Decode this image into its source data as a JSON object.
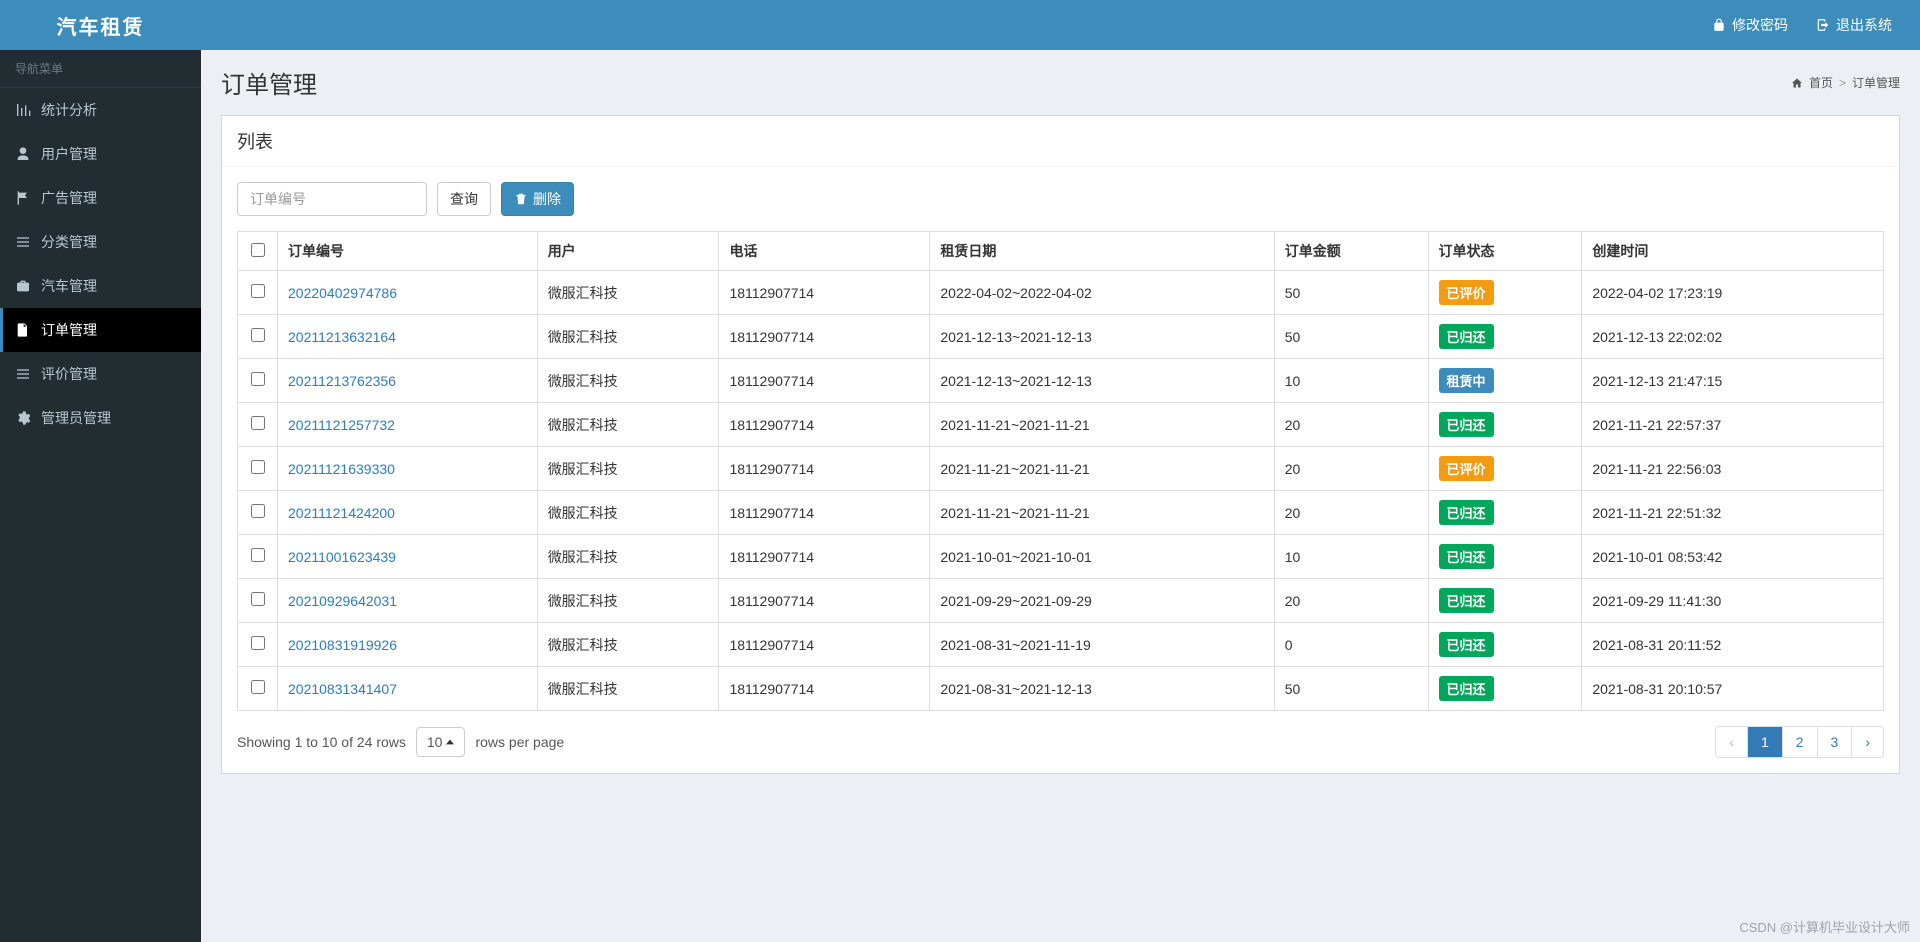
{
  "brand": "汽车租赁",
  "topActions": {
    "changePassword": "修改密码",
    "logout": "退出系统"
  },
  "sidebar": {
    "header": "导航菜单",
    "items": [
      {
        "label": "统计分析",
        "icon": "bar-chart"
      },
      {
        "label": "用户管理",
        "icon": "user"
      },
      {
        "label": "广告管理",
        "icon": "flag"
      },
      {
        "label": "分类管理",
        "icon": "list"
      },
      {
        "label": "汽车管理",
        "icon": "briefcase"
      },
      {
        "label": "订单管理",
        "icon": "file",
        "active": true
      },
      {
        "label": "评价管理",
        "icon": "list"
      },
      {
        "label": "管理员管理",
        "icon": "gear"
      }
    ]
  },
  "page": {
    "title": "订单管理",
    "breadcrumb": {
      "home": "首页",
      "current": "订单管理"
    }
  },
  "panel": {
    "title": "列表",
    "search": {
      "placeholder": "订单编号"
    },
    "buttons": {
      "query": "查询",
      "delete": "删除"
    }
  },
  "table": {
    "headers": [
      "订单编号",
      "用户",
      "电话",
      "租赁日期",
      "订单金额",
      "订单状态",
      "创建时间"
    ],
    "statusMap": {
      "evaluated": {
        "label": "已评价",
        "cls": "badge-warning"
      },
      "returned": {
        "label": "已归还",
        "cls": "badge-success"
      },
      "renting": {
        "label": "租赁中",
        "cls": "badge-primary"
      }
    },
    "rows": [
      {
        "orderNo": "20220402974786",
        "user": "微服汇科技",
        "phone": "18112907714",
        "period": "2022-04-02~2022-04-02",
        "amount": "50",
        "status": "evaluated",
        "created": "2022-04-02 17:23:19"
      },
      {
        "orderNo": "20211213632164",
        "user": "微服汇科技",
        "phone": "18112907714",
        "period": "2021-12-13~2021-12-13",
        "amount": "50",
        "status": "returned",
        "created": "2021-12-13 22:02:02"
      },
      {
        "orderNo": "20211213762356",
        "user": "微服汇科技",
        "phone": "18112907714",
        "period": "2021-12-13~2021-12-13",
        "amount": "10",
        "status": "renting",
        "created": "2021-12-13 21:47:15"
      },
      {
        "orderNo": "20211121257732",
        "user": "微服汇科技",
        "phone": "18112907714",
        "period": "2021-11-21~2021-11-21",
        "amount": "20",
        "status": "returned",
        "created": "2021-11-21 22:57:37"
      },
      {
        "orderNo": "20211121639330",
        "user": "微服汇科技",
        "phone": "18112907714",
        "period": "2021-11-21~2021-11-21",
        "amount": "20",
        "status": "evaluated",
        "created": "2021-11-21 22:56:03"
      },
      {
        "orderNo": "20211121424200",
        "user": "微服汇科技",
        "phone": "18112907714",
        "period": "2021-11-21~2021-11-21",
        "amount": "20",
        "status": "returned",
        "created": "2021-11-21 22:51:32"
      },
      {
        "orderNo": "20211001623439",
        "user": "微服汇科技",
        "phone": "18112907714",
        "period": "2021-10-01~2021-10-01",
        "amount": "10",
        "status": "returned",
        "created": "2021-10-01 08:53:42"
      },
      {
        "orderNo": "20210929642031",
        "user": "微服汇科技",
        "phone": "18112907714",
        "period": "2021-09-29~2021-09-29",
        "amount": "20",
        "status": "returned",
        "created": "2021-09-29 11:41:30"
      },
      {
        "orderNo": "20210831919926",
        "user": "微服汇科技",
        "phone": "18112907714",
        "period": "2021-08-31~2021-11-19",
        "amount": "0",
        "status": "returned",
        "created": "2021-08-31 20:11:52"
      },
      {
        "orderNo": "20210831341407",
        "user": "微服汇科技",
        "phone": "18112907714",
        "period": "2021-08-31~2021-12-13",
        "amount": "50",
        "status": "returned",
        "created": "2021-08-31 20:10:57"
      }
    ]
  },
  "footer": {
    "summary": "Showing 1 to 10 of 24 rows",
    "pageSize": "10",
    "perPageLabel": "rows per page",
    "pages": [
      "1",
      "2",
      "3"
    ],
    "activePage": "1"
  },
  "watermark": "CSDN @计算机毕业设计大师"
}
